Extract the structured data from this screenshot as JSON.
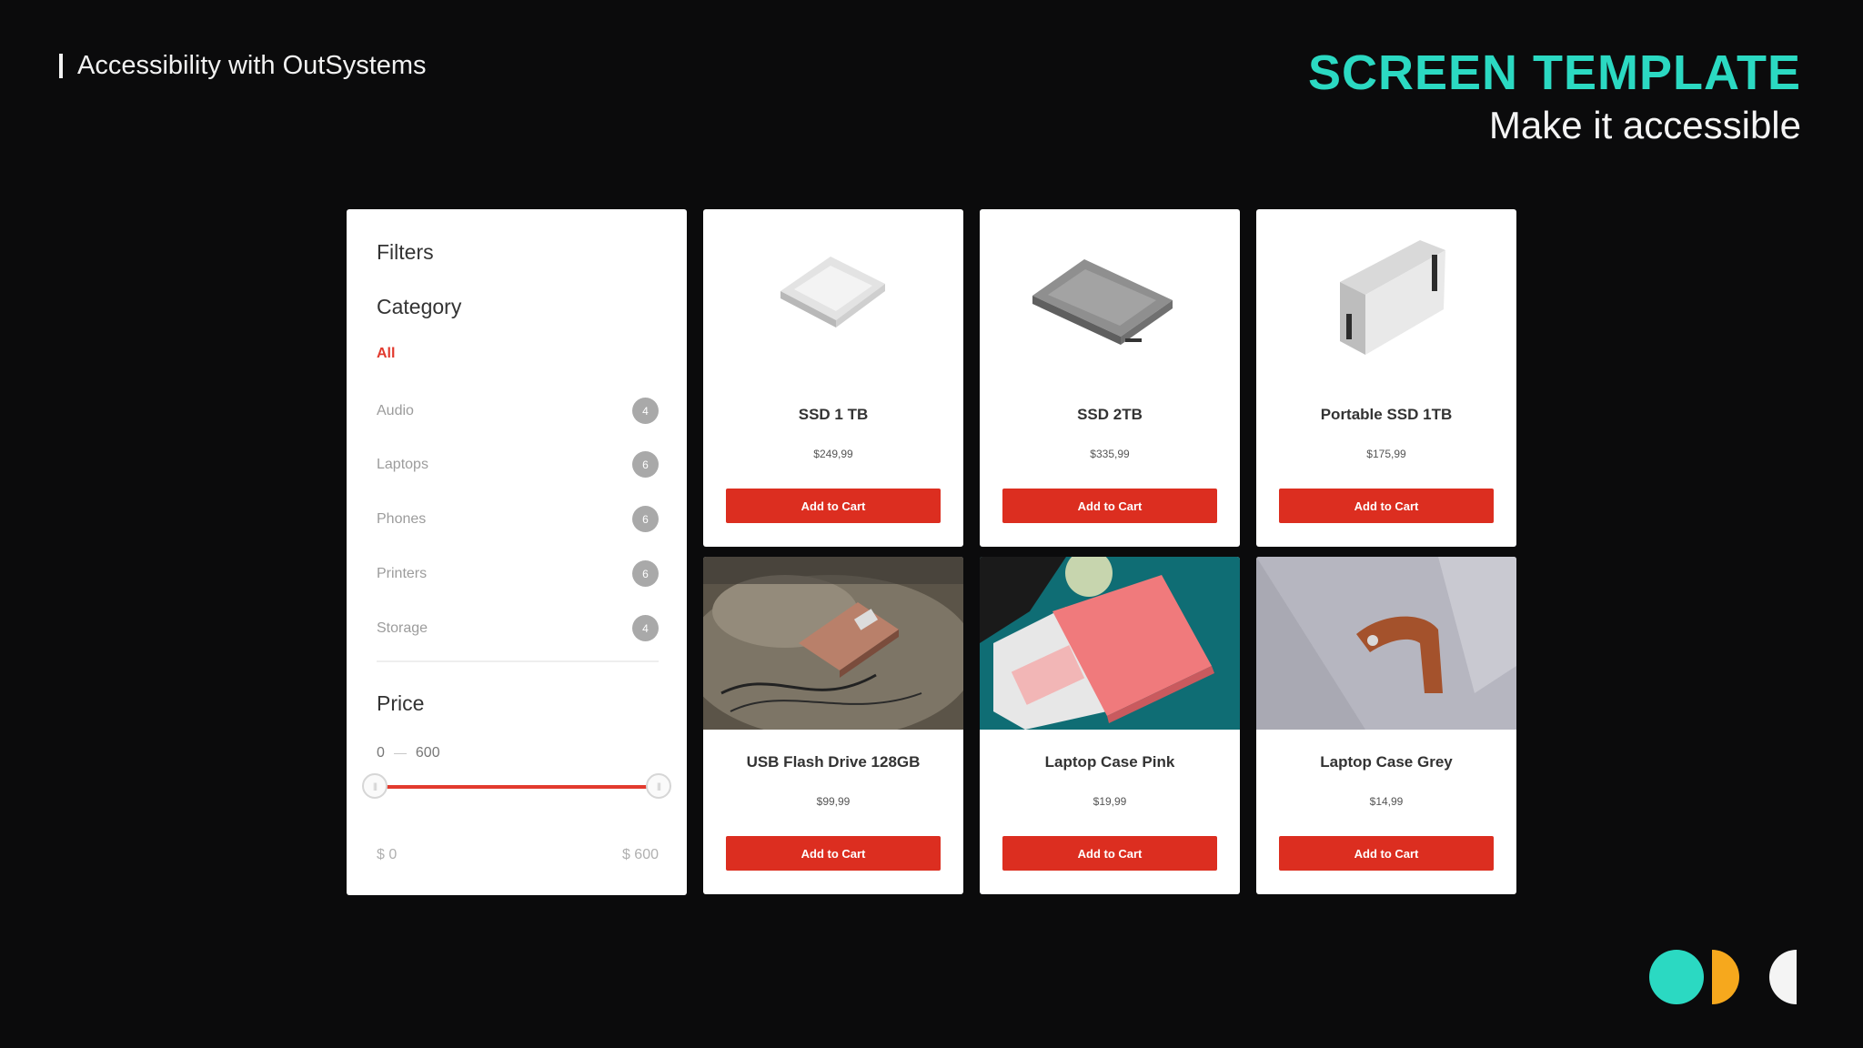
{
  "header": {
    "kicker": "Accessibility with OutSystems",
    "title": "SCREEN TEMPLATE",
    "subtitle": "Make it accessible"
  },
  "filters": {
    "heading": "Filters",
    "category_heading": "Category",
    "categories": [
      {
        "label": "All",
        "count": "",
        "selected": true
      },
      {
        "label": "Audio",
        "count": "4"
      },
      {
        "label": "Laptops",
        "count": "6"
      },
      {
        "label": "Phones",
        "count": "6"
      },
      {
        "label": "Printers",
        "count": "6"
      },
      {
        "label": "Storage",
        "count": "4"
      }
    ],
    "price_heading": "Price",
    "range_min": "0",
    "range_max": "600",
    "slider_min_label": "$ 0",
    "slider_max_label": "$ 600",
    "slider_low_fraction": 0,
    "slider_high_fraction": 1
  },
  "products": [
    {
      "name": "SSD 1 TB",
      "price": "$249,99",
      "button": "Add to Cart",
      "image": "ssd-silver"
    },
    {
      "name": "SSD 2TB",
      "price": "$335,99",
      "button": "Add to Cart",
      "image": "ssd-grey"
    },
    {
      "name": "Portable SSD 1TB",
      "price": "$175,99",
      "button": "Add to Cart",
      "image": "portable-ssd"
    },
    {
      "name": "USB Flash Drive 128GB",
      "price": "$99,99",
      "button": "Add to Cart",
      "image": "usb-flash-drive-photo"
    },
    {
      "name": "Laptop Case Pink",
      "price": "$19,99",
      "button": "Add to Cart",
      "image": "laptop-case-pink-photo"
    },
    {
      "name": "Laptop Case Grey",
      "price": "$14,99",
      "button": "Add to Cart",
      "image": "laptop-case-grey-photo"
    }
  ],
  "colors": {
    "background": "#0b0b0c",
    "accent_teal": "#2bd9c2",
    "button_red": "#dc2e20",
    "logo_yellow": "#f6a81d",
    "logo_white": "#f4f4f4"
  }
}
